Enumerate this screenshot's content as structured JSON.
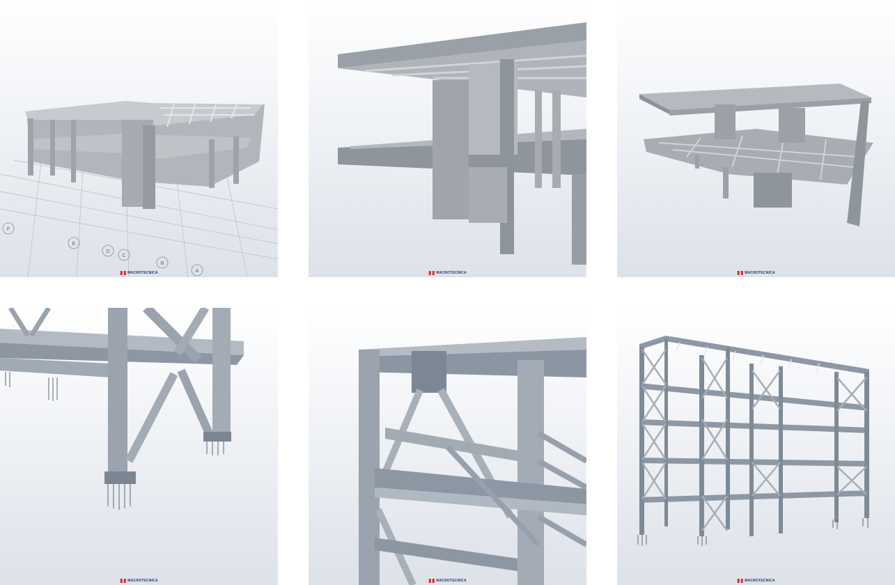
{
  "colors": {
    "brand_red": "#d52a2a",
    "brand_navy": "#1f3a6e",
    "concrete": "#a9adb3",
    "steel": "#8f9aa8"
  },
  "panels": [
    {
      "scene": "concrete-frame-on-floor-plan",
      "brand": "MACROTECNICA",
      "grid_labels": [
        "A",
        "B",
        "C",
        "D",
        "E",
        "F"
      ]
    },
    {
      "scene": "concrete-slabs-closeup",
      "brand": "MACROTECNICA"
    },
    {
      "scene": "concrete-slab-structure",
      "brand": "MACROTECNICA"
    },
    {
      "scene": "steel-column-bases-bracing",
      "brand": "MACROTECNICA"
    },
    {
      "scene": "steel-frame-closeup",
      "brand": "MACROTECNICA"
    },
    {
      "scene": "steel-braced-frame",
      "brand": "MACROTECNICA"
    }
  ]
}
